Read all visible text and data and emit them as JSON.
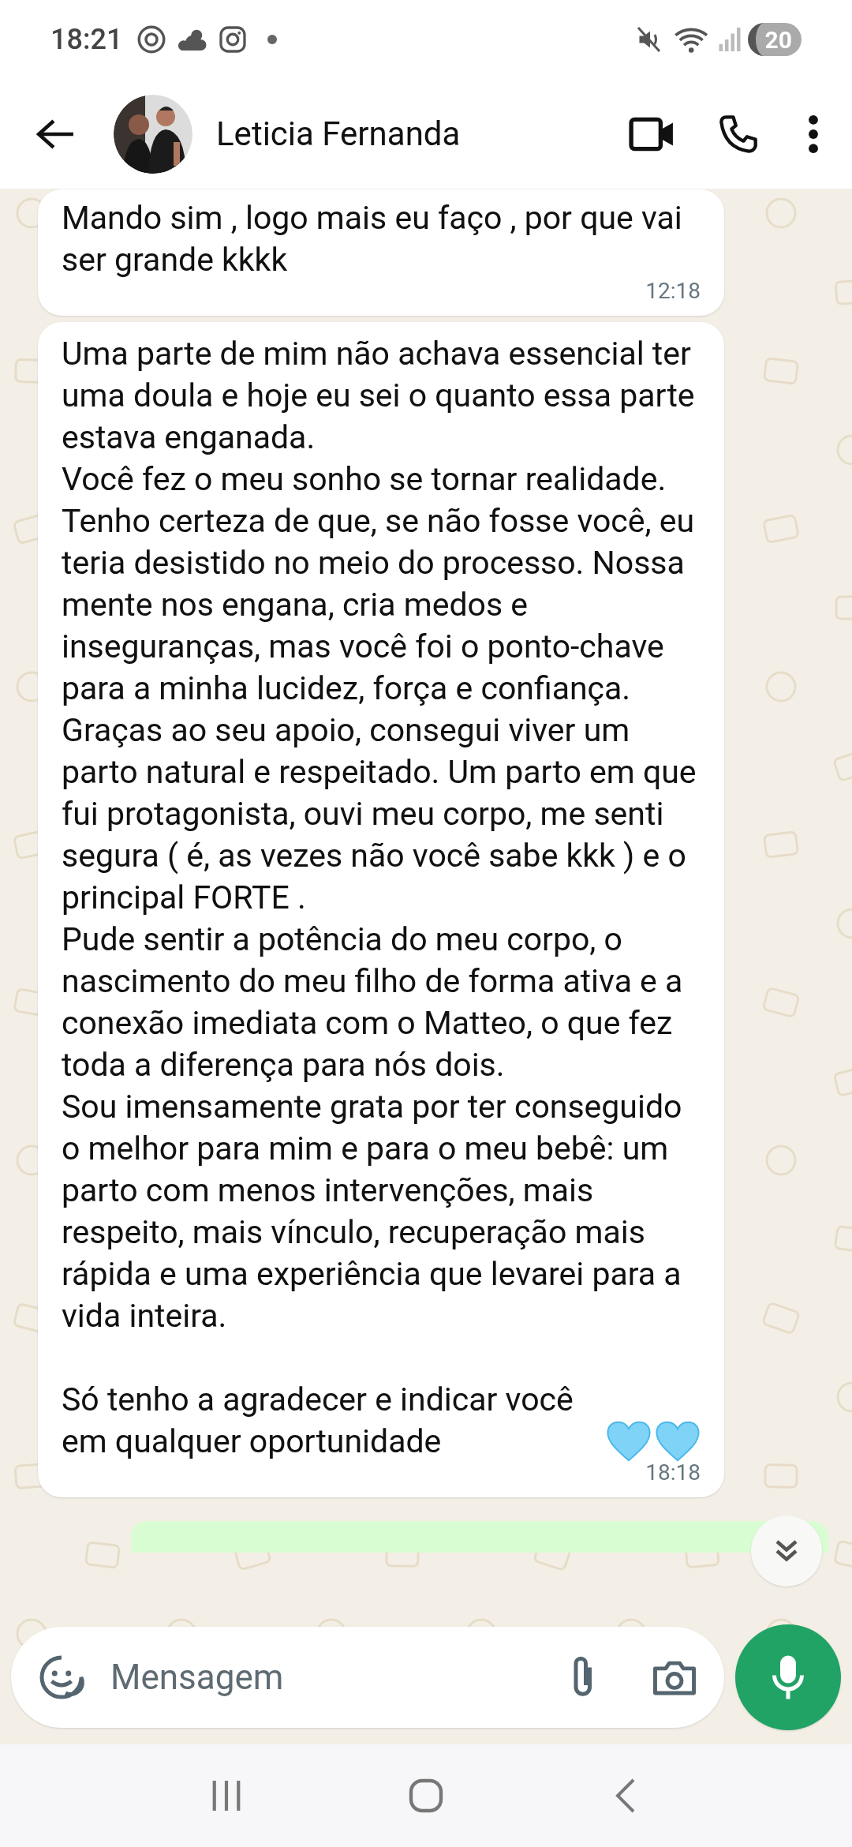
{
  "status_bar": {
    "time": "18:21",
    "battery": "20"
  },
  "header": {
    "contact_name": "Leticia Fernanda"
  },
  "messages": [
    {
      "kind": "text",
      "paragraphs": [
        "Mando sim , logo mais eu faço , por que vai ser grande kkkk"
      ],
      "time": "12:18"
    },
    {
      "kind": "text",
      "paragraphs": [
        "Uma parte de mim não achava essencial ter uma doula e hoje eu sei o quanto essa parte estava enganada.",
        "Você fez o meu sonho se tornar realidade. Tenho certeza de que, se não fosse você, eu teria desistido no meio do processo. Nossa mente nos engana, cria medos e inseguranças, mas você foi o ponto-chave para a minha lucidez, força e confiança.",
        "Graças ao seu apoio, consegui viver um parto natural e respeitado. Um parto em que fui protagonista, ouvi meu corpo, me senti segura ( é, as vezes não você sabe kkk ) e o principal FORTE .",
        "Pude sentir a potência do meu corpo, o nascimento do meu filho de forma ativa e a conexão imediata com o Matteo, o que fez toda a diferença para nós dois.",
        "Sou imensamente grata por ter conseguido o melhor para mim e para o meu bebê: um parto com menos intervenções, mais respeito, mais vínculo, recuperação mais rápida e uma experiência que levarei para a vida inteira.",
        "Só tenho a agradecer e indicar você em qualquer oportunidade"
      ],
      "time": "18:18",
      "trailing_icons": [
        {
          "kind": "heart"
        },
        {
          "kind": "heart"
        }
      ]
    }
  ],
  "composer": {
    "placeholder": "Mensagem"
  }
}
